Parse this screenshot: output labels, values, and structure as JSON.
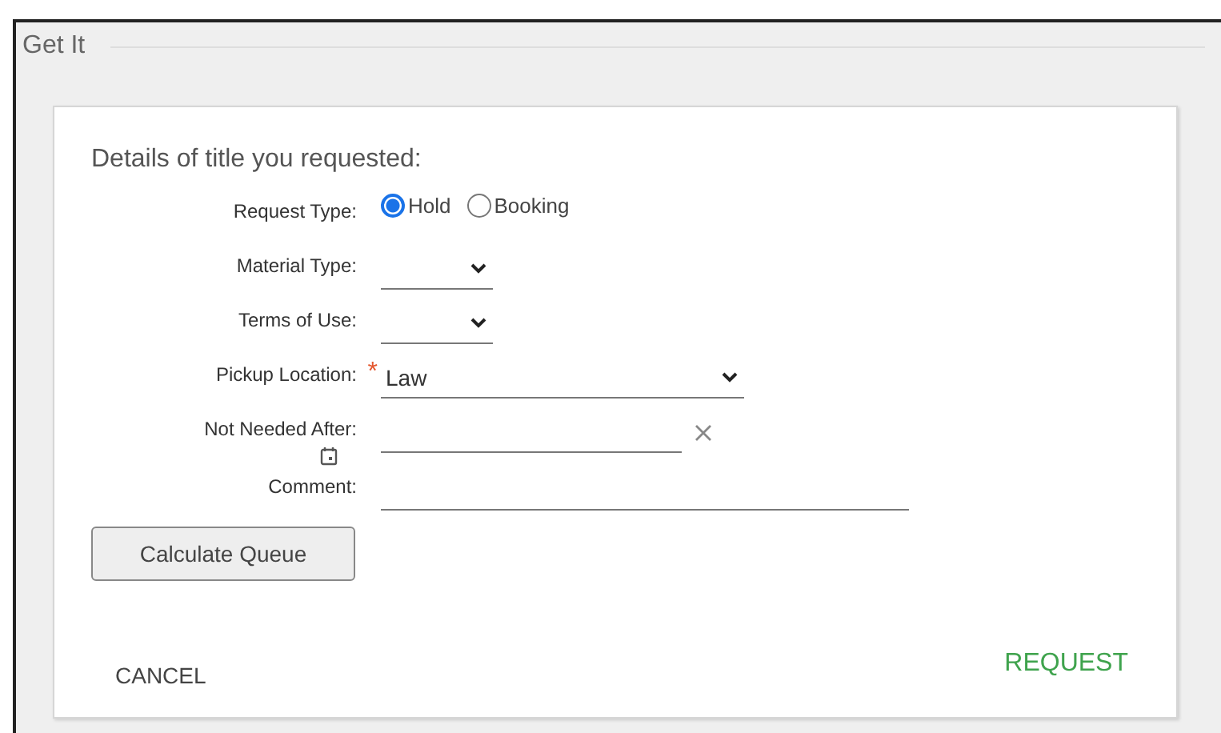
{
  "section": {
    "title": "Get It"
  },
  "form": {
    "heading": "Details of title you requested:",
    "fields": [
      {
        "kind": "radio",
        "label": "Request Type:",
        "options": [
          {
            "label": "Hold",
            "selected": true
          },
          {
            "label": "Booking",
            "selected": false
          }
        ]
      },
      {
        "kind": "select",
        "label": "Material Type:"
      },
      {
        "kind": "select",
        "label": "Terms of Use:"
      },
      {
        "kind": "select",
        "label": "Pickup Location:",
        "required_mark": "*",
        "value": "Law"
      },
      {
        "kind": "date",
        "label": "Not Needed After:"
      },
      {
        "kind": "text",
        "label": "Comment:"
      }
    ],
    "calculate_button": "Calculate Queue",
    "cancel_button": "CANCEL",
    "request_button": "REQUEST"
  }
}
